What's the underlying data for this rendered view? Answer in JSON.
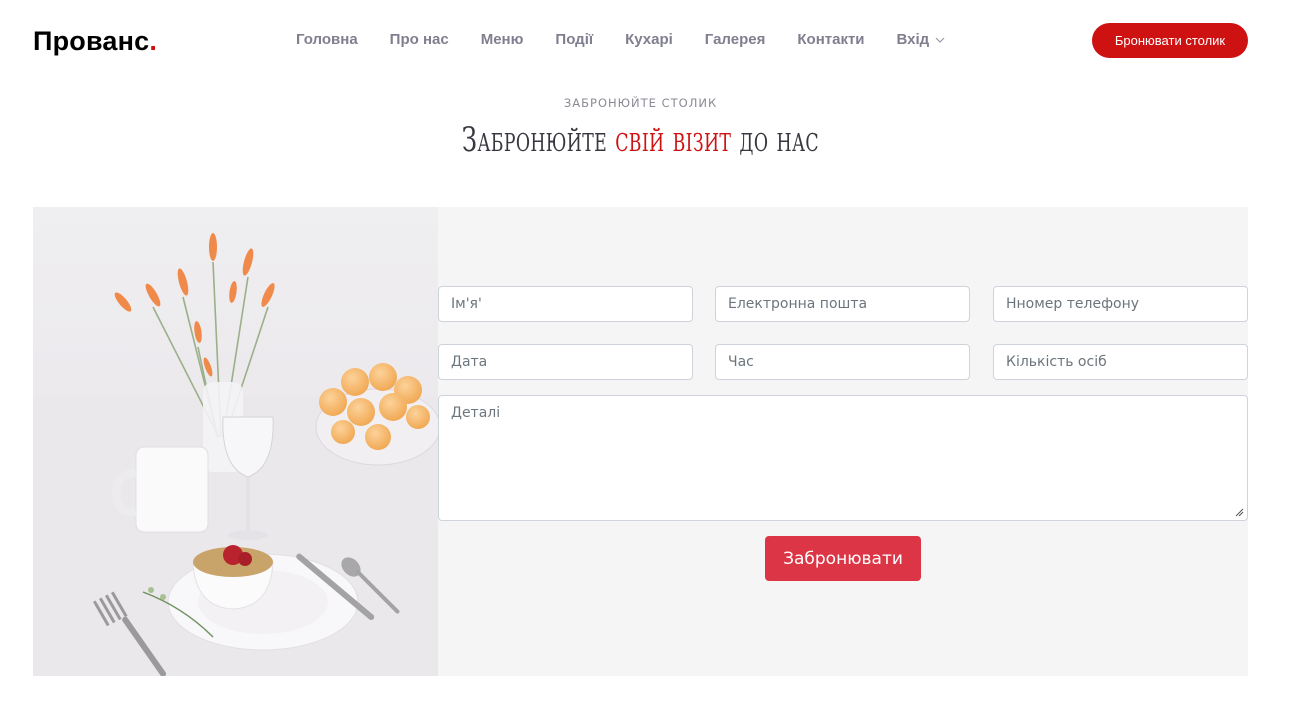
{
  "brand": {
    "name": "Прованс",
    "dot": "."
  },
  "nav": {
    "items": [
      "Головна",
      "Про нас",
      "Меню",
      "Події",
      "Кухарі",
      "Галерея",
      "Контакти"
    ],
    "dropdown_label": "Вхід"
  },
  "header_button": "Бронювати столик",
  "section": {
    "subtitle": "ЗАБРОНЮЙТЕ СТОЛИК",
    "title_before": "Забронюйте ",
    "title_accent": "свій візит",
    "title_after": " до нас"
  },
  "form": {
    "name_placeholder": "Ім'я'",
    "email_placeholder": "Електронна пошта",
    "phone_placeholder": "Нномер телефону",
    "date_placeholder": "Дата",
    "time_placeholder": "Час",
    "people_placeholder": "Кількість осіб",
    "details_placeholder": "Деталі",
    "submit_label": "Забронювати"
  },
  "colors": {
    "accent": "#ce1212",
    "submit": "#dc3545",
    "panel": "#f5f5f5"
  }
}
